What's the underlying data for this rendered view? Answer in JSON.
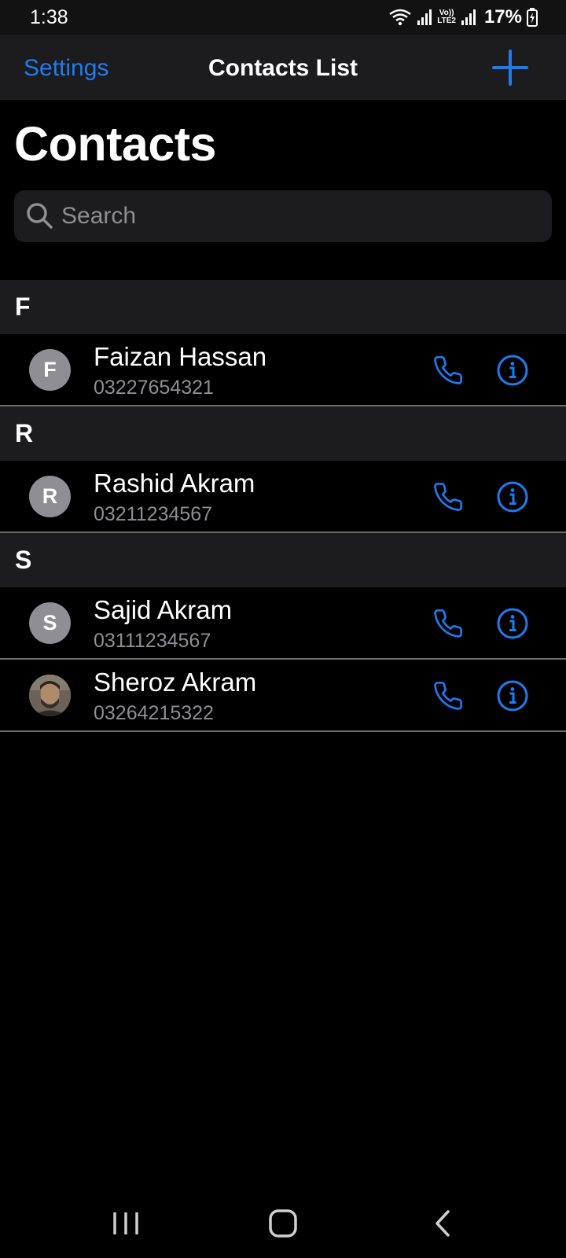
{
  "status_bar": {
    "time": "1:38",
    "battery": "17%",
    "network_label_top": "Vo))",
    "network_label_bottom": "LTE2"
  },
  "nav_bar": {
    "left_label": "Settings",
    "title": "Contacts List",
    "add_icon": "plus-icon"
  },
  "header": {
    "title": "Contacts"
  },
  "search": {
    "placeholder": "Search",
    "value": ""
  },
  "sections": [
    {
      "letter": "F",
      "contacts": [
        {
          "name": "Faizan Hassan",
          "phone": "03227654321",
          "initial": "F",
          "has_photo": false
        }
      ]
    },
    {
      "letter": "R",
      "contacts": [
        {
          "name": "Rashid Akram",
          "phone": "03211234567",
          "initial": "R",
          "has_photo": false
        }
      ]
    },
    {
      "letter": "S",
      "contacts": [
        {
          "name": "Sajid Akram",
          "phone": "03111234567",
          "initial": "S",
          "has_photo": false
        },
        {
          "name": "Sheroz Akram",
          "phone": "03264215322",
          "initial": "",
          "has_photo": true
        }
      ]
    }
  ],
  "colors": {
    "accent": "#1e7cf0",
    "background": "#000000",
    "section_background": "#1c1c1e",
    "secondary_text": "#8e8e93",
    "avatar_background": "#8e8e93"
  },
  "icons": {
    "call": "phone-icon",
    "info": "info-circle-icon",
    "search": "search-icon"
  }
}
